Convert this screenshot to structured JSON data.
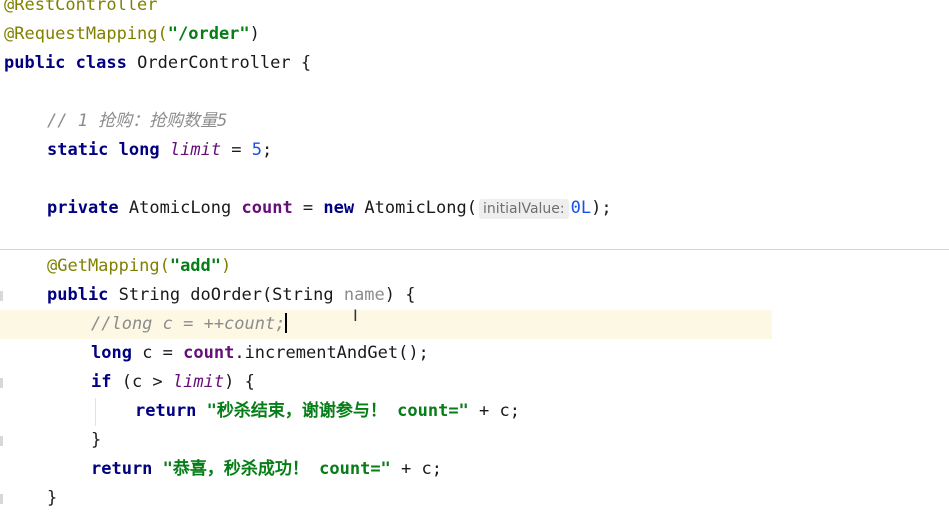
{
  "code": {
    "ann_rest": "@RestController",
    "ann_request": "@RequestMapping(",
    "request_path": "\"/order\"",
    "paren_close": ")",
    "kw_public": "public",
    "kw_class": "class",
    "class_name": "OrderController {",
    "comment_limit": "// 1 抢购：抢购数量5",
    "kw_static": "static",
    "kw_long": "long",
    "limit_name": "limit",
    "limit_assign": " = ",
    "limit_value": "5",
    "semicolon": ";",
    "kw_private": "private",
    "atomic_type": "AtomicLong ",
    "count_field": "count",
    "eq": " = ",
    "kw_new": "new",
    "atomic_ctor": " AtomicLong(",
    "hint_label": "initialValue:",
    "init_value": "0L",
    "ctor_close": ");",
    "ann_get": "@GetMapping(",
    "get_path": "\"add\"",
    "method_sig": " String doOrder(String ",
    "param_name": "name",
    "method_open": ") {",
    "commented_line": "//long c = ++count;",
    "long_c": " c = ",
    "increment_call": ".incrementAndGet();",
    "kw_if": "if",
    "if_cond_open": " (c > ",
    "if_cond_close": ") {",
    "kw_return": "return",
    "return_msg1": "\"秒杀结束，谢谢参与！ count=\"",
    "plus_c": " + c;",
    "brace_close": "}",
    "return_msg2": "\"恭喜，秒杀成功！ count=\""
  }
}
